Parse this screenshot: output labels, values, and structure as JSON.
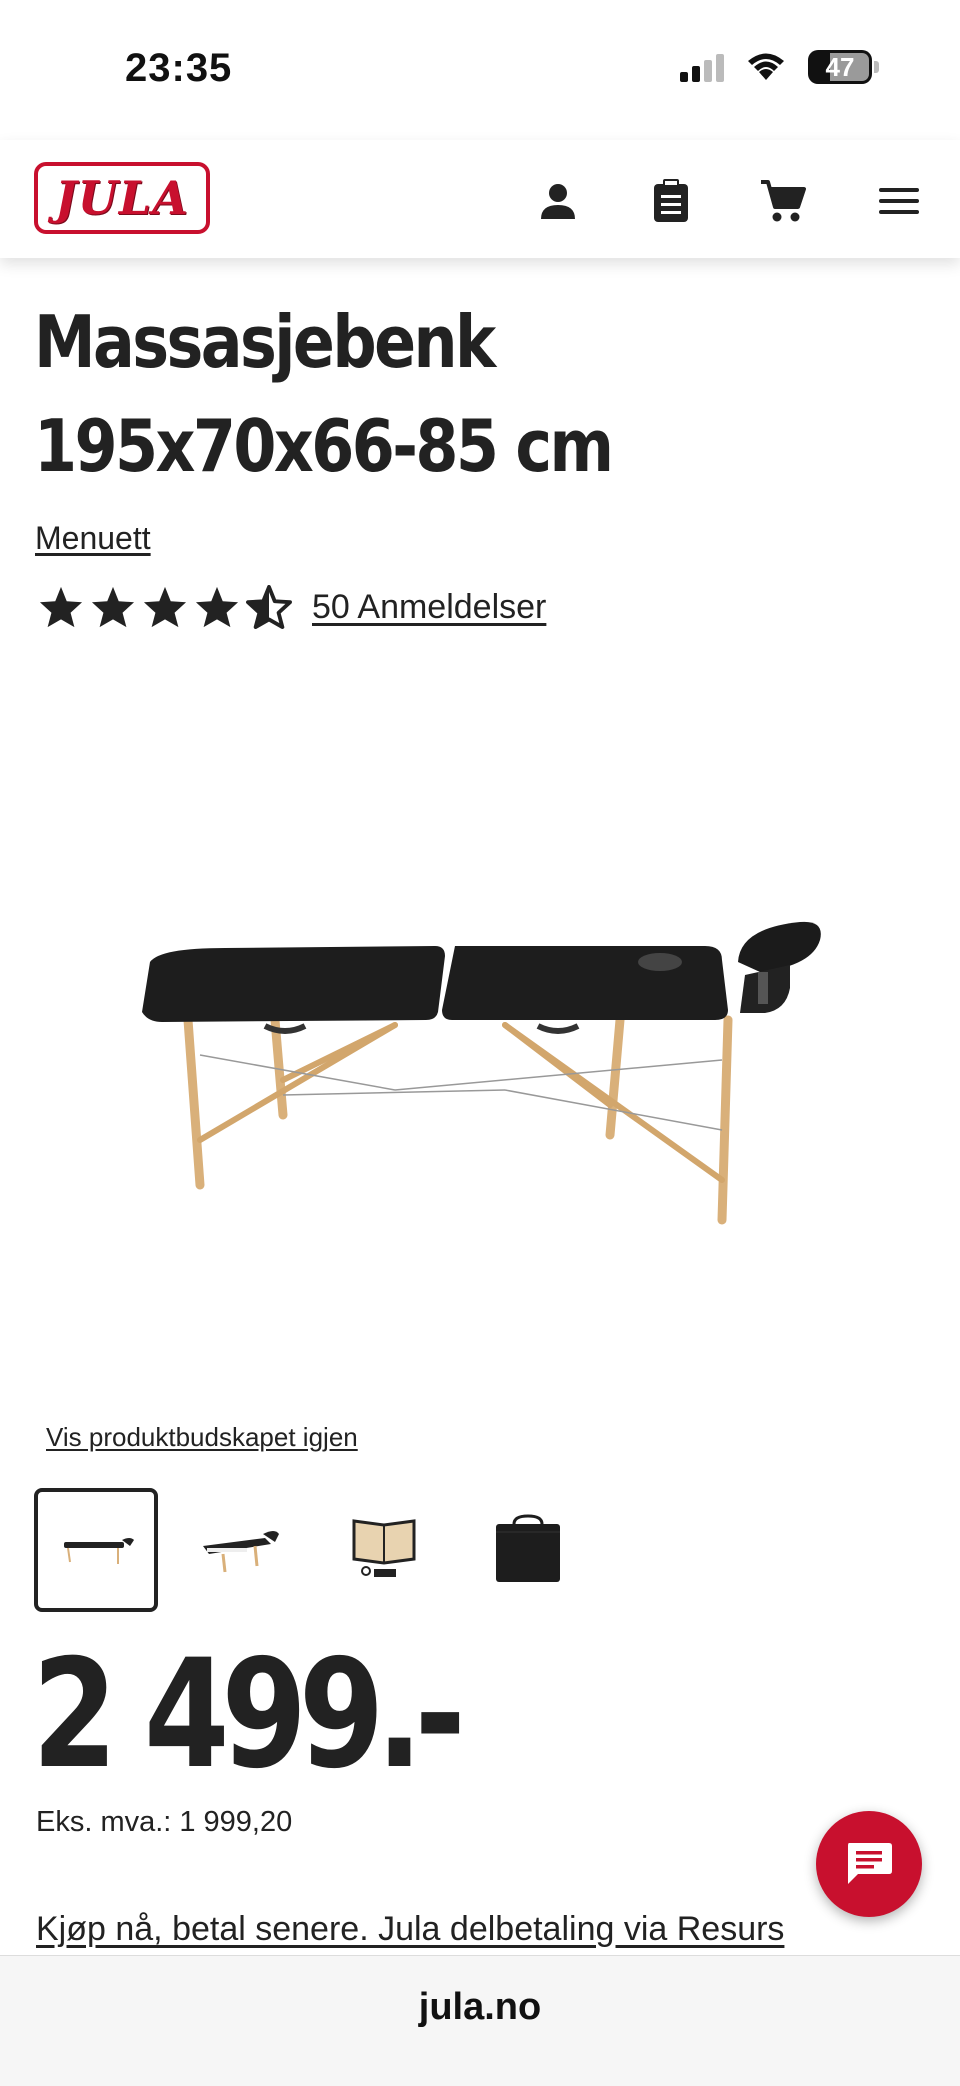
{
  "status_bar": {
    "time": "23:35",
    "battery": "47",
    "icons": [
      "signal-icon",
      "wifi-icon",
      "battery-icon"
    ]
  },
  "header": {
    "logo_text": "JULA",
    "icons": [
      "account-icon",
      "shopping-list-icon",
      "cart-icon",
      "menu-icon"
    ]
  },
  "product": {
    "title": "Massasjebenk 195x70x66-85 cm",
    "brand": "Menuett",
    "rating_stars": 4.5,
    "reviews_label": "50 Anmeldelser",
    "show_message_link": "Vis produktbudskapet igjen",
    "thumbnails": [
      "massage-table-side",
      "massage-table-angle",
      "massage-table-accessories",
      "carry-bag"
    ],
    "price": "2 499.-",
    "ex_vat_label": "Eks. mva.:",
    "ex_vat_value": "1 999,20",
    "pay_later_link": "Kjøp nå, betal senere. Jula delbetaling via Resurs"
  },
  "browser": {
    "url": "jula.no"
  },
  "colors": {
    "brand_red": "#c8102e",
    "text": "#222222"
  }
}
